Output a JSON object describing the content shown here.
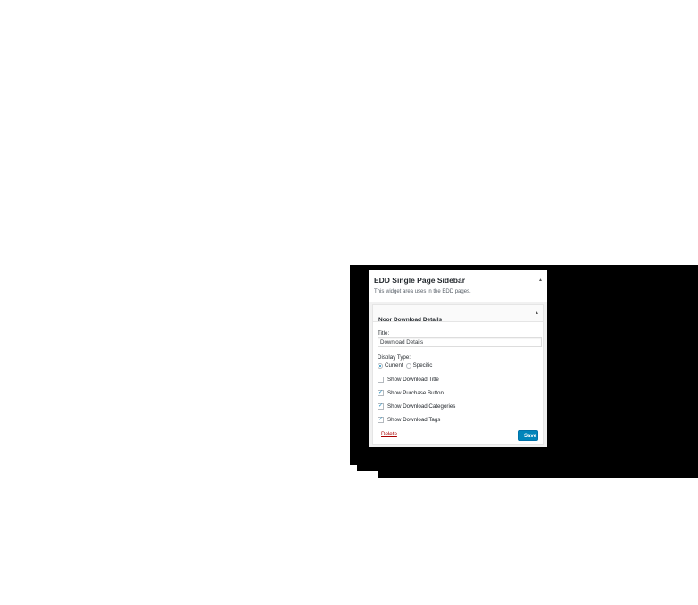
{
  "sidebar": {
    "title": "EDD Single Page Sidebar",
    "description": "This widget area uses in the EDD pages.",
    "toggle_icon": "caret-up-icon"
  },
  "widget": {
    "title": "Noor Download Details",
    "title_field_label": "Title:",
    "title_field_value": "Download Details",
    "display_type_label": "Display Type:",
    "display_type_options": [
      {
        "label": "Current",
        "selected": true
      },
      {
        "label": "Specific",
        "selected": false
      }
    ],
    "checkboxes": [
      {
        "label": "Show Download Title",
        "checked": false
      },
      {
        "label": "Show Purchase Button",
        "checked": true
      },
      {
        "label": "Show Download Categories",
        "checked": true
      },
      {
        "label": "Show Download Tags",
        "checked": true
      }
    ],
    "delete_label": "Delete",
    "save_label": "Save"
  },
  "colors": {
    "accent": "#0085ba",
    "delete": "#aa0000",
    "shadow": "#000000"
  }
}
